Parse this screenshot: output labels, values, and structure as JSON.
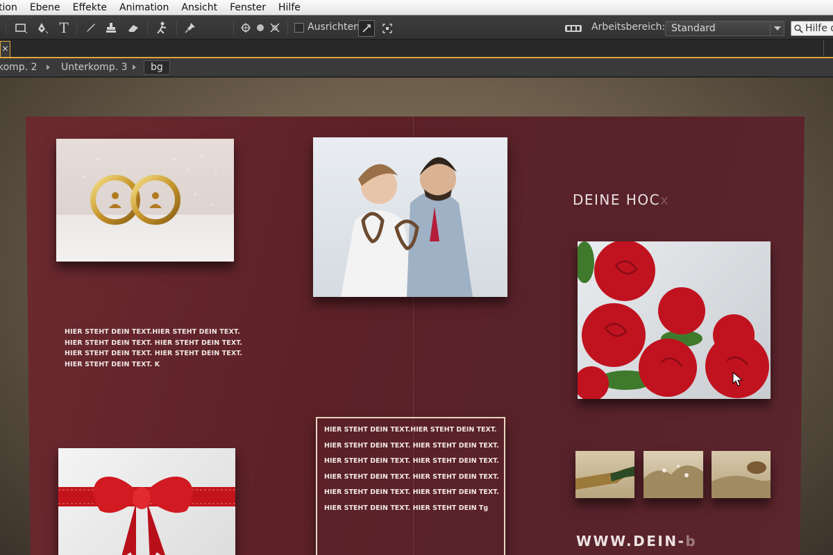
{
  "menu": {
    "items": [
      "tion",
      "Ebene",
      "Effekte",
      "Animation",
      "Ansicht",
      "Fenster",
      "Hilfe"
    ]
  },
  "toolbar": {
    "align_label": "Ausrichten",
    "align_checked": false,
    "workspace_label": "Arbeitsbereich:",
    "workspace_value": "Standard",
    "help_search_text": "Hilfe d",
    "tools": [
      "selection-tool",
      "pen-tool",
      "text-tool",
      "brush-tool",
      "clone-stamp-tool",
      "eraser-tool",
      "roto-brush-tool",
      "puppet-pin-tool"
    ]
  },
  "tabs": {
    "close_glyph": "×"
  },
  "breadcrumb": {
    "items": [
      "komp. 2",
      "Unterkomp. 3"
    ],
    "active": "bg"
  },
  "brochure": {
    "colors": {
      "background": "#5c2127",
      "text": "#efe6e4",
      "frame": "#e8d6c4"
    },
    "left_text": [
      "HIER STEHT DEIN TEXT.HIER STEHT DEIN TEXT.",
      "HIER STEHT DEIN TEXT. HIER STEHT DEIN TEXT.",
      "HIER STEHT DEIN TEXT. HIER STEHT DEIN TEXT.",
      "HIER STEHT DEIN TEXT. K"
    ],
    "box_text": [
      "HIER STEHT DEIN TEXT.HIER STEHT DEIN TEXT.",
      "HIER STEHT DEIN TEXT. HIER STEHT DEIN TEXT.",
      "HIER STEHT DEIN TEXT. HIER STEHT DEIN TEXT.",
      "HIER STEHT DEIN TEXT. HIER STEHT DEIN TEXT.",
      "HIER STEHT DEIN TEXT. HIER STEHT DEIN TEXT.",
      "HIER STEHT DEIN TEXT. HIER STEHT DEIN Tg"
    ],
    "headline": "DEINE HOC",
    "headline_ghost": "x",
    "url": "WWW.DEIN-",
    "url_ghost": "b"
  }
}
